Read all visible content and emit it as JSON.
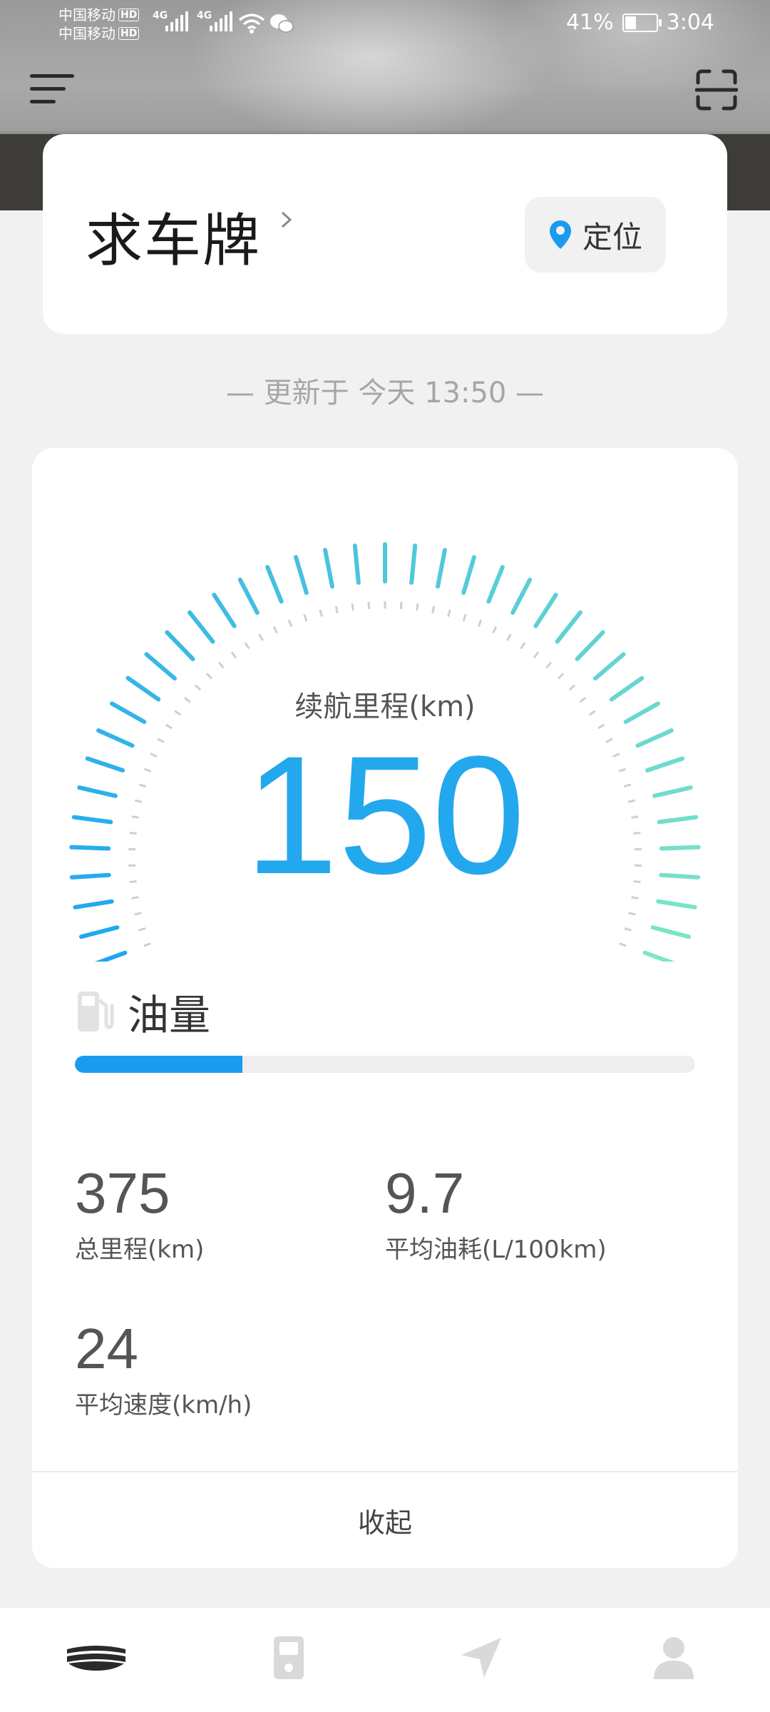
{
  "status_bar": {
    "carrier1": "中国移动",
    "carrier2": "中国移动",
    "hd": "HD",
    "network1": "4G",
    "network2": "4G",
    "battery_percent": "41%",
    "battery_level": 0.41,
    "time": "3:04"
  },
  "header": {
    "menu_icon": "menu-icon",
    "scan_icon": "scan-icon"
  },
  "vehicle": {
    "plate_placeholder": "求车牌",
    "locate_label": "定位"
  },
  "update": {
    "text": "— 更新于 今天 13:50 —"
  },
  "gauge": {
    "label": "续航里程(km)",
    "value": "150",
    "level": 1.0,
    "colors": {
      "start": "#1ea6f2",
      "end": "#7ee6c6"
    }
  },
  "fuel": {
    "label": "油量",
    "level": 0.27,
    "color": "#1a9bf0"
  },
  "stats": [
    {
      "value": "375",
      "label": "总里程(km)"
    },
    {
      "value": "9.7",
      "label": "平均油耗(L/100km)"
    },
    {
      "value": "24",
      "label": "平均速度(km/h)"
    }
  ],
  "collapse_label": "收起",
  "bottom_nav": [
    {
      "name": "vehicle-tab",
      "icon": "car-logo-icon",
      "active": true
    },
    {
      "name": "fuel-tab",
      "icon": "fuel-pump-icon",
      "active": false
    },
    {
      "name": "navigation-tab",
      "icon": "navigation-arrow-icon",
      "active": false
    },
    {
      "name": "profile-tab",
      "icon": "person-icon",
      "active": false
    }
  ]
}
